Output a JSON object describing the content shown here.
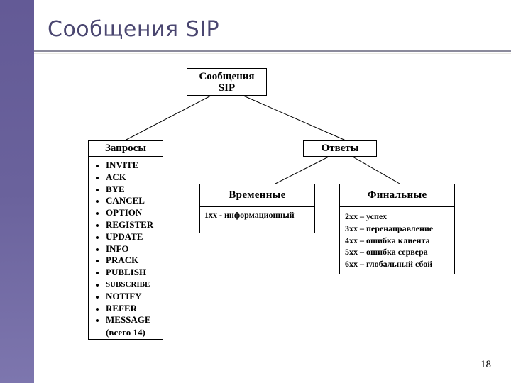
{
  "slide": {
    "title": "Сообщения SIP",
    "page_number": "18",
    "colors": {
      "sidebar": "#6a629c",
      "title_text": "#4a4670",
      "title_rule": "#8b8a9c"
    }
  },
  "diagram": {
    "root": {
      "line1": "Сообщения",
      "line2": "SIP"
    },
    "requests": {
      "label": "Запросы",
      "items": [
        "INVITE",
        "ACK",
        "BYE",
        "CANCEL",
        "OPTION",
        "REGISTER",
        "UPDATE",
        "INFO",
        "PRACK",
        "PUBLISH",
        "SUBSCRIBE",
        "NOTIFY",
        "REFER",
        "MESSAGE"
      ],
      "total": "(всего 14)"
    },
    "responses": {
      "label": "Ответы",
      "provisional": {
        "label": "Временные",
        "items": [
          "1xx - информационный"
        ]
      },
      "final": {
        "label": "Финальные",
        "items": [
          "2xx – успех",
          "3xx – перенаправление",
          "4xx – ошибка клиента",
          "5xx – ошибка сервера",
          "6xx – глобальный сбой"
        ]
      }
    }
  }
}
